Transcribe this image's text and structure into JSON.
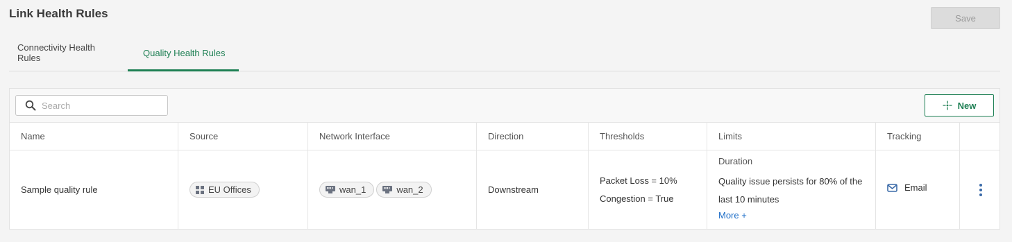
{
  "page": {
    "title": "Link Health Rules",
    "save_label": "Save"
  },
  "tabs": [
    {
      "label": "Connectivity Health Rules",
      "active": false
    },
    {
      "label": "Quality Health Rules",
      "active": true
    }
  ],
  "toolbar": {
    "search_placeholder": "Search",
    "new_label": "New"
  },
  "table": {
    "headers": [
      "Name",
      "Source",
      "Network Interface",
      "Direction",
      "Thresholds",
      "Limits",
      "Tracking"
    ],
    "rows": [
      {
        "name": "Sample quality rule",
        "source": "EU Offices",
        "interfaces": [
          "wan_1",
          "wan_2"
        ],
        "direction": "Downstream",
        "thresholds": [
          "Packet Loss = 10%",
          "Congestion = True"
        ],
        "limits": {
          "label": "Duration",
          "text": "Quality issue persists for 80% of the last 10 minutes",
          "more": "More +"
        },
        "tracking": "Email"
      }
    ]
  },
  "colors": {
    "accent": "#1d7f53",
    "link": "#1f6fc8"
  },
  "icons": {
    "search": "search-icon",
    "new": "sparkle-icon",
    "source": "grid-icon",
    "interface": "ethernet-port-icon",
    "tracking": "email-icon",
    "actions": "kebab-menu-icon"
  }
}
